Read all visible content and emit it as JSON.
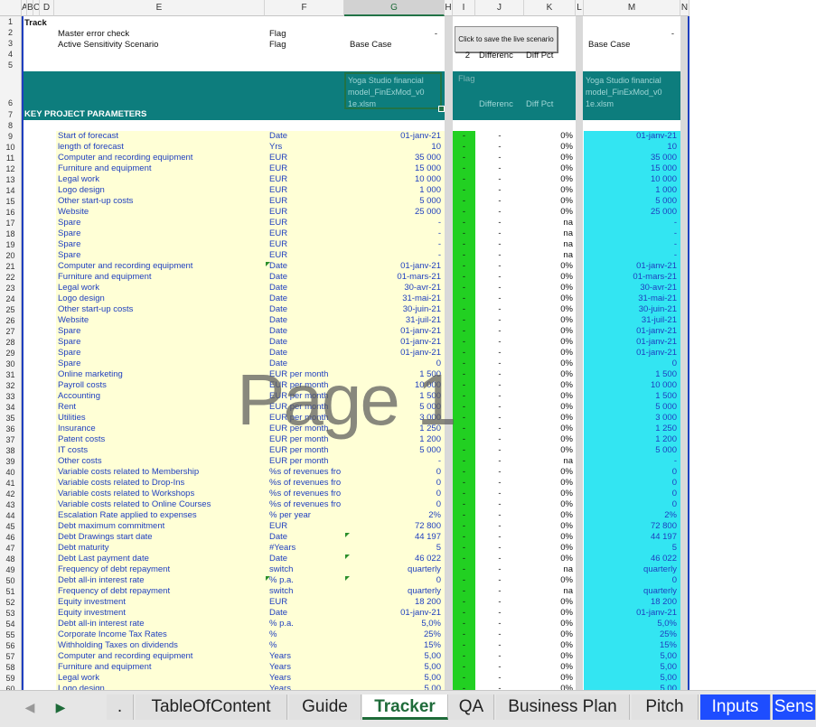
{
  "columns": [
    "A",
    "B",
    "C",
    "D",
    "E",
    "F",
    "G",
    "H",
    "I",
    "J",
    "K",
    "L",
    "M",
    "N"
  ],
  "header": {
    "track": "Track",
    "master_error_check": "Master error check",
    "active_sensitivity_scenario": "Active Sensitivity Scenario",
    "flag_label": "Flag",
    "base_case": "Base Case",
    "dash": "-",
    "save_button_label": "Click to save the live scenario",
    "row4_num": "2",
    "difference": "Differenc",
    "diff_pct": "Diff Pct",
    "file_name_line1": "Yoga Studio financial",
    "file_name_line2": "model_FinExMod_v0",
    "file_name_line3": "1e.xlsm",
    "flag_faint": "Flag",
    "key_project_parameters": "KEY PROJECT PARAMETERS"
  },
  "rows": [
    {
      "label": "Start of forecast",
      "unit": "Date",
      "value": "01-janv-21",
      "diff": "-",
      "pct": "0%",
      "live": "01-janv-21"
    },
    {
      "label": "length of forecast",
      "unit": "Yrs",
      "value": "10",
      "diff": "-",
      "pct": "0%",
      "live": "10"
    },
    {
      "label": "Computer and recording equipment",
      "unit": "EUR",
      "value": "35 000",
      "diff": "-",
      "pct": "0%",
      "live": "35 000"
    },
    {
      "label": "Furniture and equipment",
      "unit": "EUR",
      "value": "15 000",
      "diff": "-",
      "pct": "0%",
      "live": "15 000"
    },
    {
      "label": "Legal work",
      "unit": "EUR",
      "value": "10 000",
      "diff": "-",
      "pct": "0%",
      "live": "10 000"
    },
    {
      "label": "Logo design",
      "unit": "EUR",
      "value": "1 000",
      "diff": "-",
      "pct": "0%",
      "live": "1 000"
    },
    {
      "label": "Other start-up costs",
      "unit": "EUR",
      "value": "5 000",
      "diff": "-",
      "pct": "0%",
      "live": "5 000"
    },
    {
      "label": "Website",
      "unit": "EUR",
      "value": "25 000",
      "diff": "-",
      "pct": "0%",
      "live": "25 000"
    },
    {
      "label": "Spare",
      "unit": "EUR",
      "value": "-",
      "diff": "-",
      "pct": "na",
      "live": "-"
    },
    {
      "label": "Spare",
      "unit": "EUR",
      "value": "-",
      "diff": "-",
      "pct": "na",
      "live": "-"
    },
    {
      "label": "Spare",
      "unit": "EUR",
      "value": "-",
      "diff": "-",
      "pct": "na",
      "live": "-"
    },
    {
      "label": "Spare",
      "unit": "EUR",
      "value": "-",
      "diff": "-",
      "pct": "na",
      "live": "-"
    },
    {
      "label": "Computer and recording equipment",
      "unit": "Date",
      "value": "01-janv-21",
      "diff": "-",
      "pct": "0%",
      "live": "01-janv-21"
    },
    {
      "label": "Furniture and equipment",
      "unit": "Date",
      "value": "01-mars-21",
      "diff": "-",
      "pct": "0%",
      "live": "01-mars-21"
    },
    {
      "label": "Legal work",
      "unit": "Date",
      "value": "30-avr-21",
      "diff": "-",
      "pct": "0%",
      "live": "30-avr-21"
    },
    {
      "label": "Logo design",
      "unit": "Date",
      "value": "31-mai-21",
      "diff": "-",
      "pct": "0%",
      "live": "31-mai-21"
    },
    {
      "label": "Other start-up costs",
      "unit": "Date",
      "value": "30-juin-21",
      "diff": "-",
      "pct": "0%",
      "live": "30-juin-21"
    },
    {
      "label": "Website",
      "unit": "Date",
      "value": "31-juil-21",
      "diff": "-",
      "pct": "0%",
      "live": "31-juil-21"
    },
    {
      "label": "Spare",
      "unit": "Date",
      "value": "01-janv-21",
      "diff": "-",
      "pct": "0%",
      "live": "01-janv-21"
    },
    {
      "label": "Spare",
      "unit": "Date",
      "value": "01-janv-21",
      "diff": "-",
      "pct": "0%",
      "live": "01-janv-21"
    },
    {
      "label": "Spare",
      "unit": "Date",
      "value": "01-janv-21",
      "diff": "-",
      "pct": "0%",
      "live": "01-janv-21"
    },
    {
      "label": "Spare",
      "unit": "Date",
      "value": "0",
      "diff": "-",
      "pct": "0%",
      "live": "0"
    },
    {
      "label": "Online marketing",
      "unit": "EUR per month",
      "value": "1 500",
      "diff": "-",
      "pct": "0%",
      "live": "1 500"
    },
    {
      "label": "Payroll costs",
      "unit": "EUR per month",
      "value": "10 000",
      "diff": "-",
      "pct": "0%",
      "live": "10 000"
    },
    {
      "label": "Accounting",
      "unit": "EUR per month",
      "value": "1 500",
      "diff": "-",
      "pct": "0%",
      "live": "1 500"
    },
    {
      "label": "Rent",
      "unit": "EUR per month",
      "value": "5 000",
      "diff": "-",
      "pct": "0%",
      "live": "5 000"
    },
    {
      "label": "Utilities",
      "unit": "EUR per month",
      "value": "3 000",
      "diff": "-",
      "pct": "0%",
      "live": "3 000"
    },
    {
      "label": "Insurance",
      "unit": "EUR per month",
      "value": "1 250",
      "diff": "-",
      "pct": "0%",
      "live": "1 250"
    },
    {
      "label": "Patent costs",
      "unit": "EUR per month",
      "value": "1 200",
      "diff": "-",
      "pct": "0%",
      "live": "1 200"
    },
    {
      "label": "IT costs",
      "unit": "EUR per month",
      "value": "5 000",
      "diff": "-",
      "pct": "0%",
      "live": "5 000"
    },
    {
      "label": "Other costs",
      "unit": "EUR per month",
      "value": "-",
      "diff": "-",
      "pct": "na",
      "live": "-"
    },
    {
      "label": "Variable costs related to Membership",
      "unit": "%s of revenues fro",
      "value": "0",
      "diff": "-",
      "pct": "0%",
      "live": "0"
    },
    {
      "label": "Variable costs related to Drop-Ins",
      "unit": "%s of revenues fro",
      "value": "0",
      "diff": "-",
      "pct": "0%",
      "live": "0"
    },
    {
      "label": "Variable costs related to Workshops",
      "unit": "%s of revenues fro",
      "value": "0",
      "diff": "-",
      "pct": "0%",
      "live": "0"
    },
    {
      "label": "Variable costs related to Online Courses",
      "unit": "%s of revenues fro",
      "value": "0",
      "diff": "-",
      "pct": "0%",
      "live": "0"
    },
    {
      "label": "Escalation Rate applied to expenses",
      "unit": "% per year",
      "value": "2%",
      "diff": "-",
      "pct": "0%",
      "live": "2%"
    },
    {
      "label": "Debt maximum commitment",
      "unit": "EUR",
      "value": "72 800",
      "diff": "-",
      "pct": "0%",
      "live": "72 800"
    },
    {
      "label": " Debt  Drawings start date",
      "unit": "Date",
      "value": "44 197",
      "diff": "-",
      "pct": "0%",
      "live": "44 197"
    },
    {
      "label": " Debt  maturity",
      "unit": "#Years",
      "value": "5",
      "diff": "-",
      "pct": "0%",
      "live": "5"
    },
    {
      "label": " Debt  Last payment date",
      "unit": "Date",
      "value": "46 022",
      "diff": "-",
      "pct": "0%",
      "live": "46 022"
    },
    {
      "label": "Frequency of debt repayment",
      "unit": "switch",
      "value": "quarterly",
      "diff": "-",
      "pct": "na",
      "live": "quarterly"
    },
    {
      "label": " Debt  all-in interest rate",
      "unit": "% p.a.",
      "value": "0",
      "diff": "-",
      "pct": "0%",
      "live": "0"
    },
    {
      "label": "Frequency of debt repayment",
      "unit": "switch",
      "value": "quarterly",
      "diff": "-",
      "pct": "na",
      "live": "quarterly"
    },
    {
      "label": "Equity investment",
      "unit": "EUR",
      "value": "18 200",
      "diff": "-",
      "pct": "0%",
      "live": "18 200"
    },
    {
      "label": "Equity investment",
      "unit": "Date",
      "value": "01-janv-21",
      "diff": "-",
      "pct": "0%",
      "live": "01-janv-21"
    },
    {
      "label": " Debt  all-in interest rate",
      "unit": "% p.a.",
      "value": "5,0%",
      "diff": "-",
      "pct": "0%",
      "live": "5,0%"
    },
    {
      "label": "Corporate Income Tax Rates",
      "unit": "%",
      "value": "25%",
      "diff": "-",
      "pct": "0%",
      "live": "25%"
    },
    {
      "label": "Withholding Taxes on dividends",
      "unit": "%",
      "value": "15%",
      "diff": "-",
      "pct": "0%",
      "live": "15%"
    },
    {
      "label": "Computer and recording equipment",
      "unit": "Years",
      "value": "5,00",
      "diff": "-",
      "pct": "0%",
      "live": "5,00"
    },
    {
      "label": "Furniture and equipment",
      "unit": "Years",
      "value": "5,00",
      "diff": "-",
      "pct": "0%",
      "live": "5,00"
    },
    {
      "label": "Legal work",
      "unit": "Years",
      "value": "5,00",
      "diff": "-",
      "pct": "0%",
      "live": "5,00"
    },
    {
      "label": "Logo design",
      "unit": "Years",
      "value": "5,00",
      "diff": "-",
      "pct": "0%",
      "live": "5,00"
    }
  ],
  "watermark": "Page 1",
  "tabs": [
    {
      "label": ".",
      "style": "normal"
    },
    {
      "label": "TableOfContent",
      "style": "normal"
    },
    {
      "label": "Guide",
      "style": "normal"
    },
    {
      "label": "Tracker",
      "style": "active"
    },
    {
      "label": "QA",
      "style": "normal"
    },
    {
      "label": "Business Plan",
      "style": "normal"
    },
    {
      "label": "Pitch",
      "style": "normal"
    },
    {
      "label": "Inputs",
      "style": "blue"
    },
    {
      "label": "Sens",
      "style": "blue"
    }
  ],
  "nav": {
    "prev": "◀",
    "next": "▶"
  }
}
